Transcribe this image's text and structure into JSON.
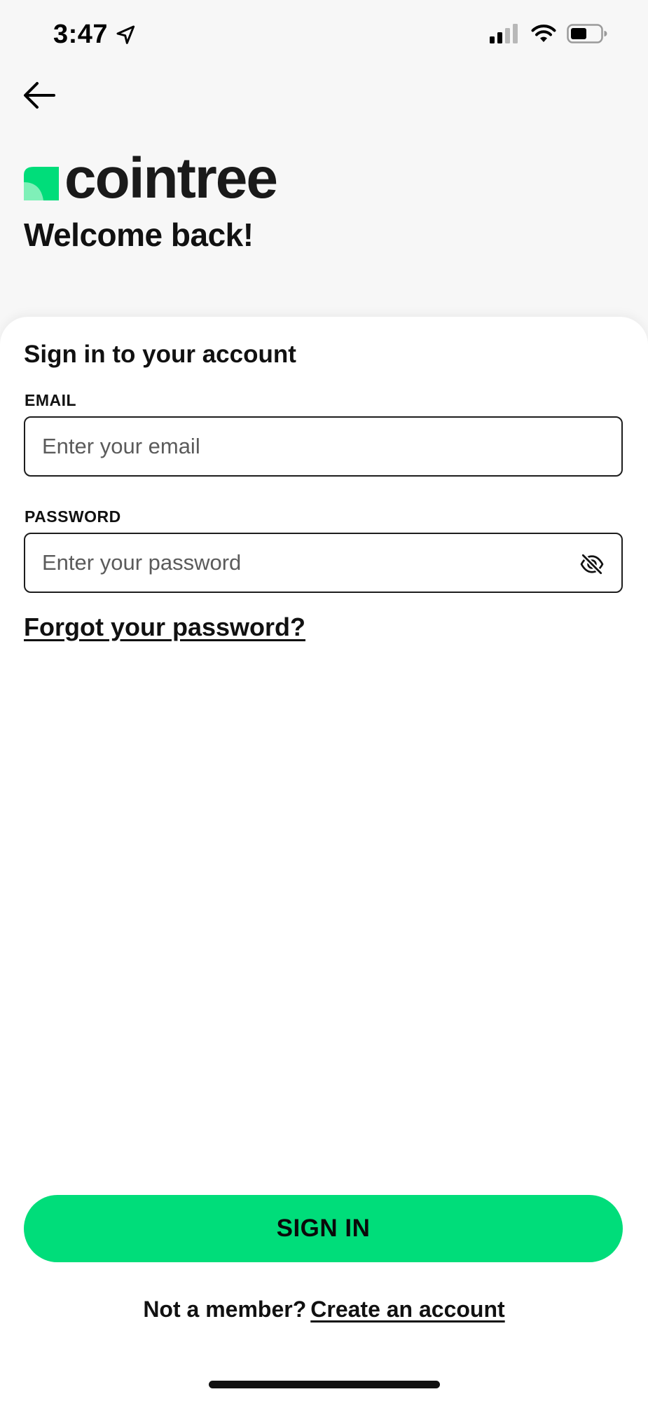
{
  "status_bar": {
    "time": "3:47"
  },
  "brand": {
    "name": "cointree",
    "accent_color": "#00dd7a"
  },
  "header": {
    "welcome": "Welcome back!"
  },
  "form": {
    "title": "Sign in to your account",
    "email_label": "EMAIL",
    "email_placeholder": "Enter your email",
    "email_value": "",
    "password_label": "PASSWORD",
    "password_placeholder": "Enter your password",
    "password_value": "",
    "forgot_link": "Forgot your password?"
  },
  "actions": {
    "signin_label": "SIGN IN"
  },
  "footer": {
    "prompt": "Not a member?",
    "create_link": "Create an account"
  },
  "icons": {
    "back": "back-arrow-icon",
    "location": "location-arrow-icon",
    "signal": "cellular-signal-icon",
    "wifi": "wifi-icon",
    "battery": "battery-icon",
    "password_toggle": "eye-off-icon"
  }
}
